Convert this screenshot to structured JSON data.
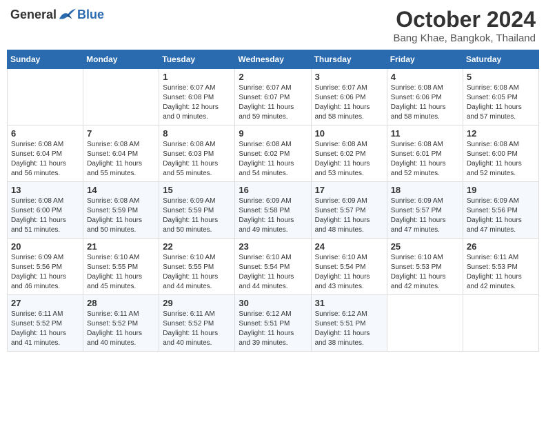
{
  "header": {
    "logo": {
      "general": "General",
      "blue": "Blue"
    },
    "title": "October 2024",
    "location": "Bang Khae, Bangkok, Thailand"
  },
  "calendar": {
    "days_of_week": [
      "Sunday",
      "Monday",
      "Tuesday",
      "Wednesday",
      "Thursday",
      "Friday",
      "Saturday"
    ],
    "weeks": [
      [
        {
          "day": "",
          "info": ""
        },
        {
          "day": "",
          "info": ""
        },
        {
          "day": "1",
          "info": "Sunrise: 6:07 AM\nSunset: 6:08 PM\nDaylight: 12 hours\nand 0 minutes."
        },
        {
          "day": "2",
          "info": "Sunrise: 6:07 AM\nSunset: 6:07 PM\nDaylight: 11 hours\nand 59 minutes."
        },
        {
          "day": "3",
          "info": "Sunrise: 6:07 AM\nSunset: 6:06 PM\nDaylight: 11 hours\nand 58 minutes."
        },
        {
          "day": "4",
          "info": "Sunrise: 6:08 AM\nSunset: 6:06 PM\nDaylight: 11 hours\nand 58 minutes."
        },
        {
          "day": "5",
          "info": "Sunrise: 6:08 AM\nSunset: 6:05 PM\nDaylight: 11 hours\nand 57 minutes."
        }
      ],
      [
        {
          "day": "6",
          "info": "Sunrise: 6:08 AM\nSunset: 6:04 PM\nDaylight: 11 hours\nand 56 minutes."
        },
        {
          "day": "7",
          "info": "Sunrise: 6:08 AM\nSunset: 6:04 PM\nDaylight: 11 hours\nand 55 minutes."
        },
        {
          "day": "8",
          "info": "Sunrise: 6:08 AM\nSunset: 6:03 PM\nDaylight: 11 hours\nand 55 minutes."
        },
        {
          "day": "9",
          "info": "Sunrise: 6:08 AM\nSunset: 6:02 PM\nDaylight: 11 hours\nand 54 minutes."
        },
        {
          "day": "10",
          "info": "Sunrise: 6:08 AM\nSunset: 6:02 PM\nDaylight: 11 hours\nand 53 minutes."
        },
        {
          "day": "11",
          "info": "Sunrise: 6:08 AM\nSunset: 6:01 PM\nDaylight: 11 hours\nand 52 minutes."
        },
        {
          "day": "12",
          "info": "Sunrise: 6:08 AM\nSunset: 6:00 PM\nDaylight: 11 hours\nand 52 minutes."
        }
      ],
      [
        {
          "day": "13",
          "info": "Sunrise: 6:08 AM\nSunset: 6:00 PM\nDaylight: 11 hours\nand 51 minutes."
        },
        {
          "day": "14",
          "info": "Sunrise: 6:08 AM\nSunset: 5:59 PM\nDaylight: 11 hours\nand 50 minutes."
        },
        {
          "day": "15",
          "info": "Sunrise: 6:09 AM\nSunset: 5:59 PM\nDaylight: 11 hours\nand 50 minutes."
        },
        {
          "day": "16",
          "info": "Sunrise: 6:09 AM\nSunset: 5:58 PM\nDaylight: 11 hours\nand 49 minutes."
        },
        {
          "day": "17",
          "info": "Sunrise: 6:09 AM\nSunset: 5:57 PM\nDaylight: 11 hours\nand 48 minutes."
        },
        {
          "day": "18",
          "info": "Sunrise: 6:09 AM\nSunset: 5:57 PM\nDaylight: 11 hours\nand 47 minutes."
        },
        {
          "day": "19",
          "info": "Sunrise: 6:09 AM\nSunset: 5:56 PM\nDaylight: 11 hours\nand 47 minutes."
        }
      ],
      [
        {
          "day": "20",
          "info": "Sunrise: 6:09 AM\nSunset: 5:56 PM\nDaylight: 11 hours\nand 46 minutes."
        },
        {
          "day": "21",
          "info": "Sunrise: 6:10 AM\nSunset: 5:55 PM\nDaylight: 11 hours\nand 45 minutes."
        },
        {
          "day": "22",
          "info": "Sunrise: 6:10 AM\nSunset: 5:55 PM\nDaylight: 11 hours\nand 44 minutes."
        },
        {
          "day": "23",
          "info": "Sunrise: 6:10 AM\nSunset: 5:54 PM\nDaylight: 11 hours\nand 44 minutes."
        },
        {
          "day": "24",
          "info": "Sunrise: 6:10 AM\nSunset: 5:54 PM\nDaylight: 11 hours\nand 43 minutes."
        },
        {
          "day": "25",
          "info": "Sunrise: 6:10 AM\nSunset: 5:53 PM\nDaylight: 11 hours\nand 42 minutes."
        },
        {
          "day": "26",
          "info": "Sunrise: 6:11 AM\nSunset: 5:53 PM\nDaylight: 11 hours\nand 42 minutes."
        }
      ],
      [
        {
          "day": "27",
          "info": "Sunrise: 6:11 AM\nSunset: 5:52 PM\nDaylight: 11 hours\nand 41 minutes."
        },
        {
          "day": "28",
          "info": "Sunrise: 6:11 AM\nSunset: 5:52 PM\nDaylight: 11 hours\nand 40 minutes."
        },
        {
          "day": "29",
          "info": "Sunrise: 6:11 AM\nSunset: 5:52 PM\nDaylight: 11 hours\nand 40 minutes."
        },
        {
          "day": "30",
          "info": "Sunrise: 6:12 AM\nSunset: 5:51 PM\nDaylight: 11 hours\nand 39 minutes."
        },
        {
          "day": "31",
          "info": "Sunrise: 6:12 AM\nSunset: 5:51 PM\nDaylight: 11 hours\nand 38 minutes."
        },
        {
          "day": "",
          "info": ""
        },
        {
          "day": "",
          "info": ""
        }
      ]
    ]
  }
}
